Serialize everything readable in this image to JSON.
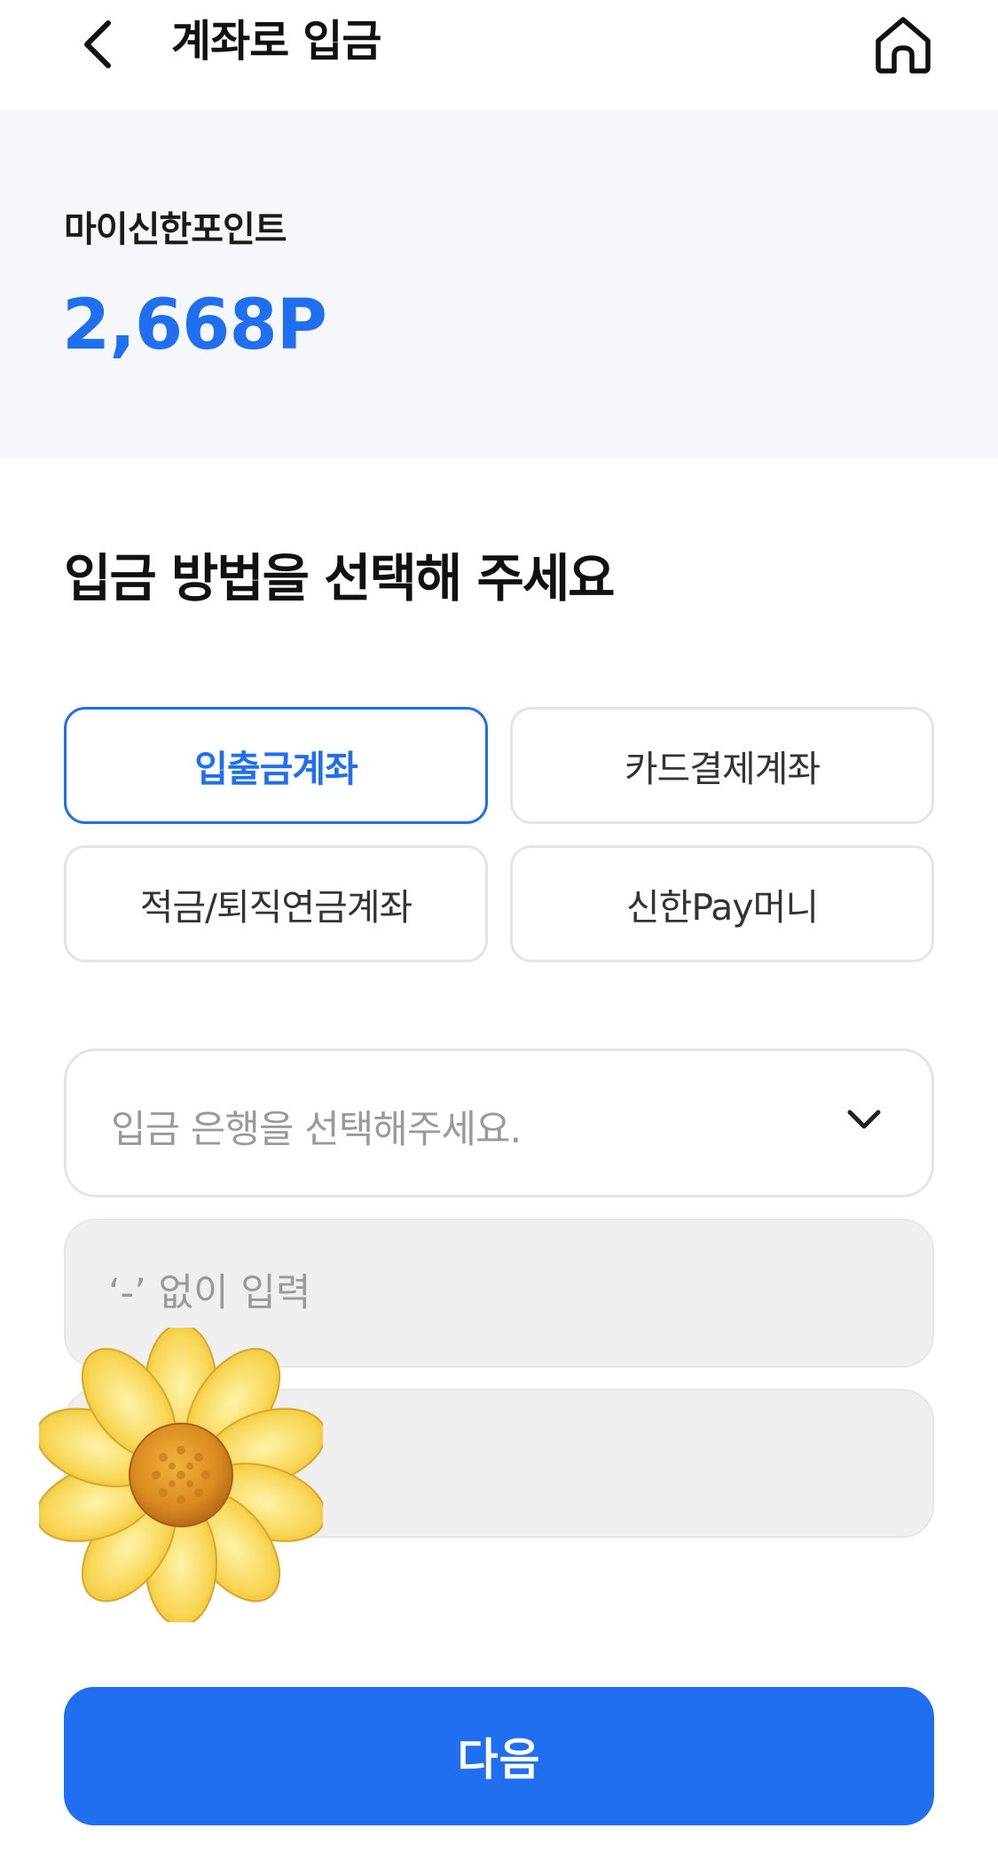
{
  "header": {
    "title": "계좌로 입금",
    "back_icon": "chevron-left-icon",
    "home_icon": "home-icon"
  },
  "points": {
    "label": "마이신한포인트",
    "value": "2,668P",
    "accent_color": "#1f6ff0"
  },
  "section": {
    "title": "입금 방법을 선택해 주세요"
  },
  "methods": [
    {
      "label": "입출금계좌",
      "selected": true
    },
    {
      "label": "카드결제계좌",
      "selected": false
    },
    {
      "label": "적금/퇴직연금계좌",
      "selected": false
    },
    {
      "label": "신한Pay머니",
      "selected": false
    }
  ],
  "bank_select": {
    "placeholder": "입금 은행을 선택해주세요.",
    "icon": "chevron-down-icon"
  },
  "account_input": {
    "placeholder": "‘-’ 없이 입력",
    "value": ""
  },
  "amount_input": {
    "placeholder": "",
    "value": ""
  },
  "overlay": {
    "icon": "flower-emoji"
  },
  "next_button": {
    "label": "다음",
    "color": "#1f6ff0"
  }
}
